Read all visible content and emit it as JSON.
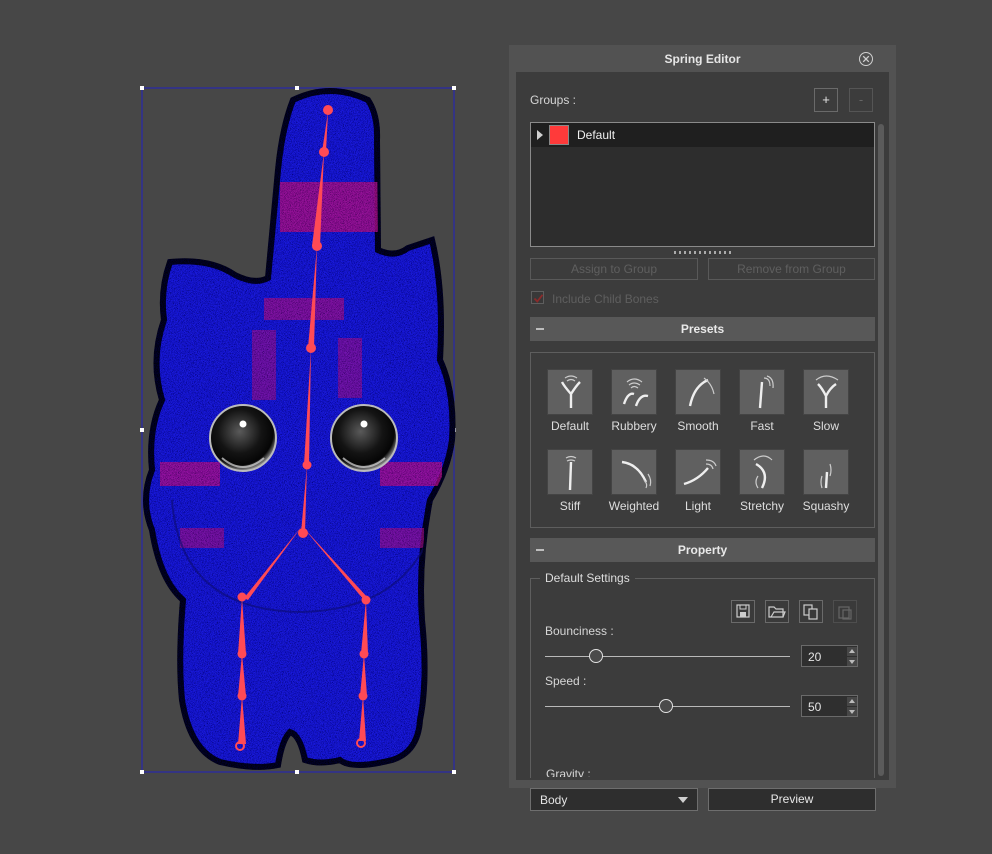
{
  "panel": {
    "title": "Spring Editor",
    "groups_label": "Groups :",
    "add_label": "+",
    "remove_label": "-",
    "groups": [
      {
        "name": "Default",
        "color": "#ff3a3a"
      }
    ],
    "assign_label": "Assign to Group",
    "remove_from_group_label": "Remove from Group",
    "include_child_label": "Include Child Bones",
    "include_child_checked": true,
    "presets_header": "Presets",
    "presets": [
      {
        "name": "Default",
        "icon": "spring-default-icon"
      },
      {
        "name": "Rubbery",
        "icon": "spring-rubbery-icon"
      },
      {
        "name": "Smooth",
        "icon": "spring-smooth-icon"
      },
      {
        "name": "Fast",
        "icon": "spring-fast-icon"
      },
      {
        "name": "Slow",
        "icon": "spring-slow-icon"
      },
      {
        "name": "Stiff",
        "icon": "spring-stiff-icon"
      },
      {
        "name": "Weighted",
        "icon": "spring-weighted-icon"
      },
      {
        "name": "Light",
        "icon": "spring-light-icon"
      },
      {
        "name": "Stretchy",
        "icon": "spring-stretchy-icon"
      },
      {
        "name": "Squashy",
        "icon": "spring-squashy-icon"
      }
    ],
    "property_header": "Property",
    "settings_title": "Default Settings",
    "bounciness_label": "Bounciness :",
    "bounciness_value": "20",
    "speed_label": "Speed :",
    "speed_value": "50",
    "gravity_label": "Gravity :",
    "body_select_value": "Body",
    "preview_label": "Preview"
  },
  "colors": {
    "accent": "#ff3a3a",
    "panel_bg": "#3c3c3c",
    "canvas_bg": "#474747",
    "character_fill": "#1a1ae0",
    "bone_color": "#ff4a55"
  }
}
